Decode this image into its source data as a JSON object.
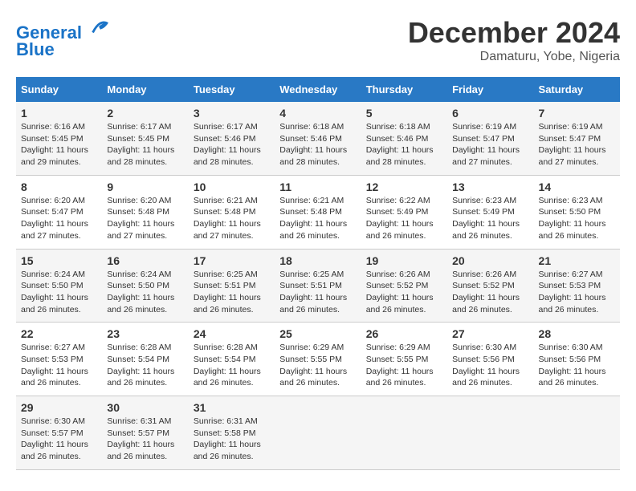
{
  "header": {
    "logo_line1": "General",
    "logo_line2": "Blue",
    "month": "December 2024",
    "location": "Damaturu, Yobe, Nigeria"
  },
  "weekdays": [
    "Sunday",
    "Monday",
    "Tuesday",
    "Wednesday",
    "Thursday",
    "Friday",
    "Saturday"
  ],
  "weeks": [
    [
      {
        "day": "1",
        "rise": "6:16 AM",
        "set": "5:45 PM",
        "hours": "11",
        "mins": "29"
      },
      {
        "day": "2",
        "rise": "6:17 AM",
        "set": "5:45 PM",
        "hours": "11",
        "mins": "28"
      },
      {
        "day": "3",
        "rise": "6:17 AM",
        "set": "5:46 PM",
        "hours": "11",
        "mins": "28"
      },
      {
        "day": "4",
        "rise": "6:18 AM",
        "set": "5:46 PM",
        "hours": "11",
        "mins": "28"
      },
      {
        "day": "5",
        "rise": "6:18 AM",
        "set": "5:46 PM",
        "hours": "11",
        "mins": "28"
      },
      {
        "day": "6",
        "rise": "6:19 AM",
        "set": "5:47 PM",
        "hours": "11",
        "mins": "27"
      },
      {
        "day": "7",
        "rise": "6:19 AM",
        "set": "5:47 PM",
        "hours": "11",
        "mins": "27"
      }
    ],
    [
      {
        "day": "8",
        "rise": "6:20 AM",
        "set": "5:47 PM",
        "hours": "11",
        "mins": "27"
      },
      {
        "day": "9",
        "rise": "6:20 AM",
        "set": "5:48 PM",
        "hours": "11",
        "mins": "27"
      },
      {
        "day": "10",
        "rise": "6:21 AM",
        "set": "5:48 PM",
        "hours": "11",
        "mins": "27"
      },
      {
        "day": "11",
        "rise": "6:21 AM",
        "set": "5:48 PM",
        "hours": "11",
        "mins": "26"
      },
      {
        "day": "12",
        "rise": "6:22 AM",
        "set": "5:49 PM",
        "hours": "11",
        "mins": "26"
      },
      {
        "day": "13",
        "rise": "6:23 AM",
        "set": "5:49 PM",
        "hours": "11",
        "mins": "26"
      },
      {
        "day": "14",
        "rise": "6:23 AM",
        "set": "5:50 PM",
        "hours": "11",
        "mins": "26"
      }
    ],
    [
      {
        "day": "15",
        "rise": "6:24 AM",
        "set": "5:50 PM",
        "hours": "11",
        "mins": "26"
      },
      {
        "day": "16",
        "rise": "6:24 AM",
        "set": "5:50 PM",
        "hours": "11",
        "mins": "26"
      },
      {
        "day": "17",
        "rise": "6:25 AM",
        "set": "5:51 PM",
        "hours": "11",
        "mins": "26"
      },
      {
        "day": "18",
        "rise": "6:25 AM",
        "set": "5:51 PM",
        "hours": "11",
        "mins": "26"
      },
      {
        "day": "19",
        "rise": "6:26 AM",
        "set": "5:52 PM",
        "hours": "11",
        "mins": "26"
      },
      {
        "day": "20",
        "rise": "6:26 AM",
        "set": "5:52 PM",
        "hours": "11",
        "mins": "26"
      },
      {
        "day": "21",
        "rise": "6:27 AM",
        "set": "5:53 PM",
        "hours": "11",
        "mins": "26"
      }
    ],
    [
      {
        "day": "22",
        "rise": "6:27 AM",
        "set": "5:53 PM",
        "hours": "11",
        "mins": "26"
      },
      {
        "day": "23",
        "rise": "6:28 AM",
        "set": "5:54 PM",
        "hours": "11",
        "mins": "26"
      },
      {
        "day": "24",
        "rise": "6:28 AM",
        "set": "5:54 PM",
        "hours": "11",
        "mins": "26"
      },
      {
        "day": "25",
        "rise": "6:29 AM",
        "set": "5:55 PM",
        "hours": "11",
        "mins": "26"
      },
      {
        "day": "26",
        "rise": "6:29 AM",
        "set": "5:55 PM",
        "hours": "11",
        "mins": "26"
      },
      {
        "day": "27",
        "rise": "6:30 AM",
        "set": "5:56 PM",
        "hours": "11",
        "mins": "26"
      },
      {
        "day": "28",
        "rise": "6:30 AM",
        "set": "5:56 PM",
        "hours": "11",
        "mins": "26"
      }
    ],
    [
      {
        "day": "29",
        "rise": "6:30 AM",
        "set": "5:57 PM",
        "hours": "11",
        "mins": "26"
      },
      {
        "day": "30",
        "rise": "6:31 AM",
        "set": "5:57 PM",
        "hours": "11",
        "mins": "26"
      },
      {
        "day": "31",
        "rise": "6:31 AM",
        "set": "5:58 PM",
        "hours": "11",
        "mins": "26"
      },
      null,
      null,
      null,
      null
    ]
  ]
}
